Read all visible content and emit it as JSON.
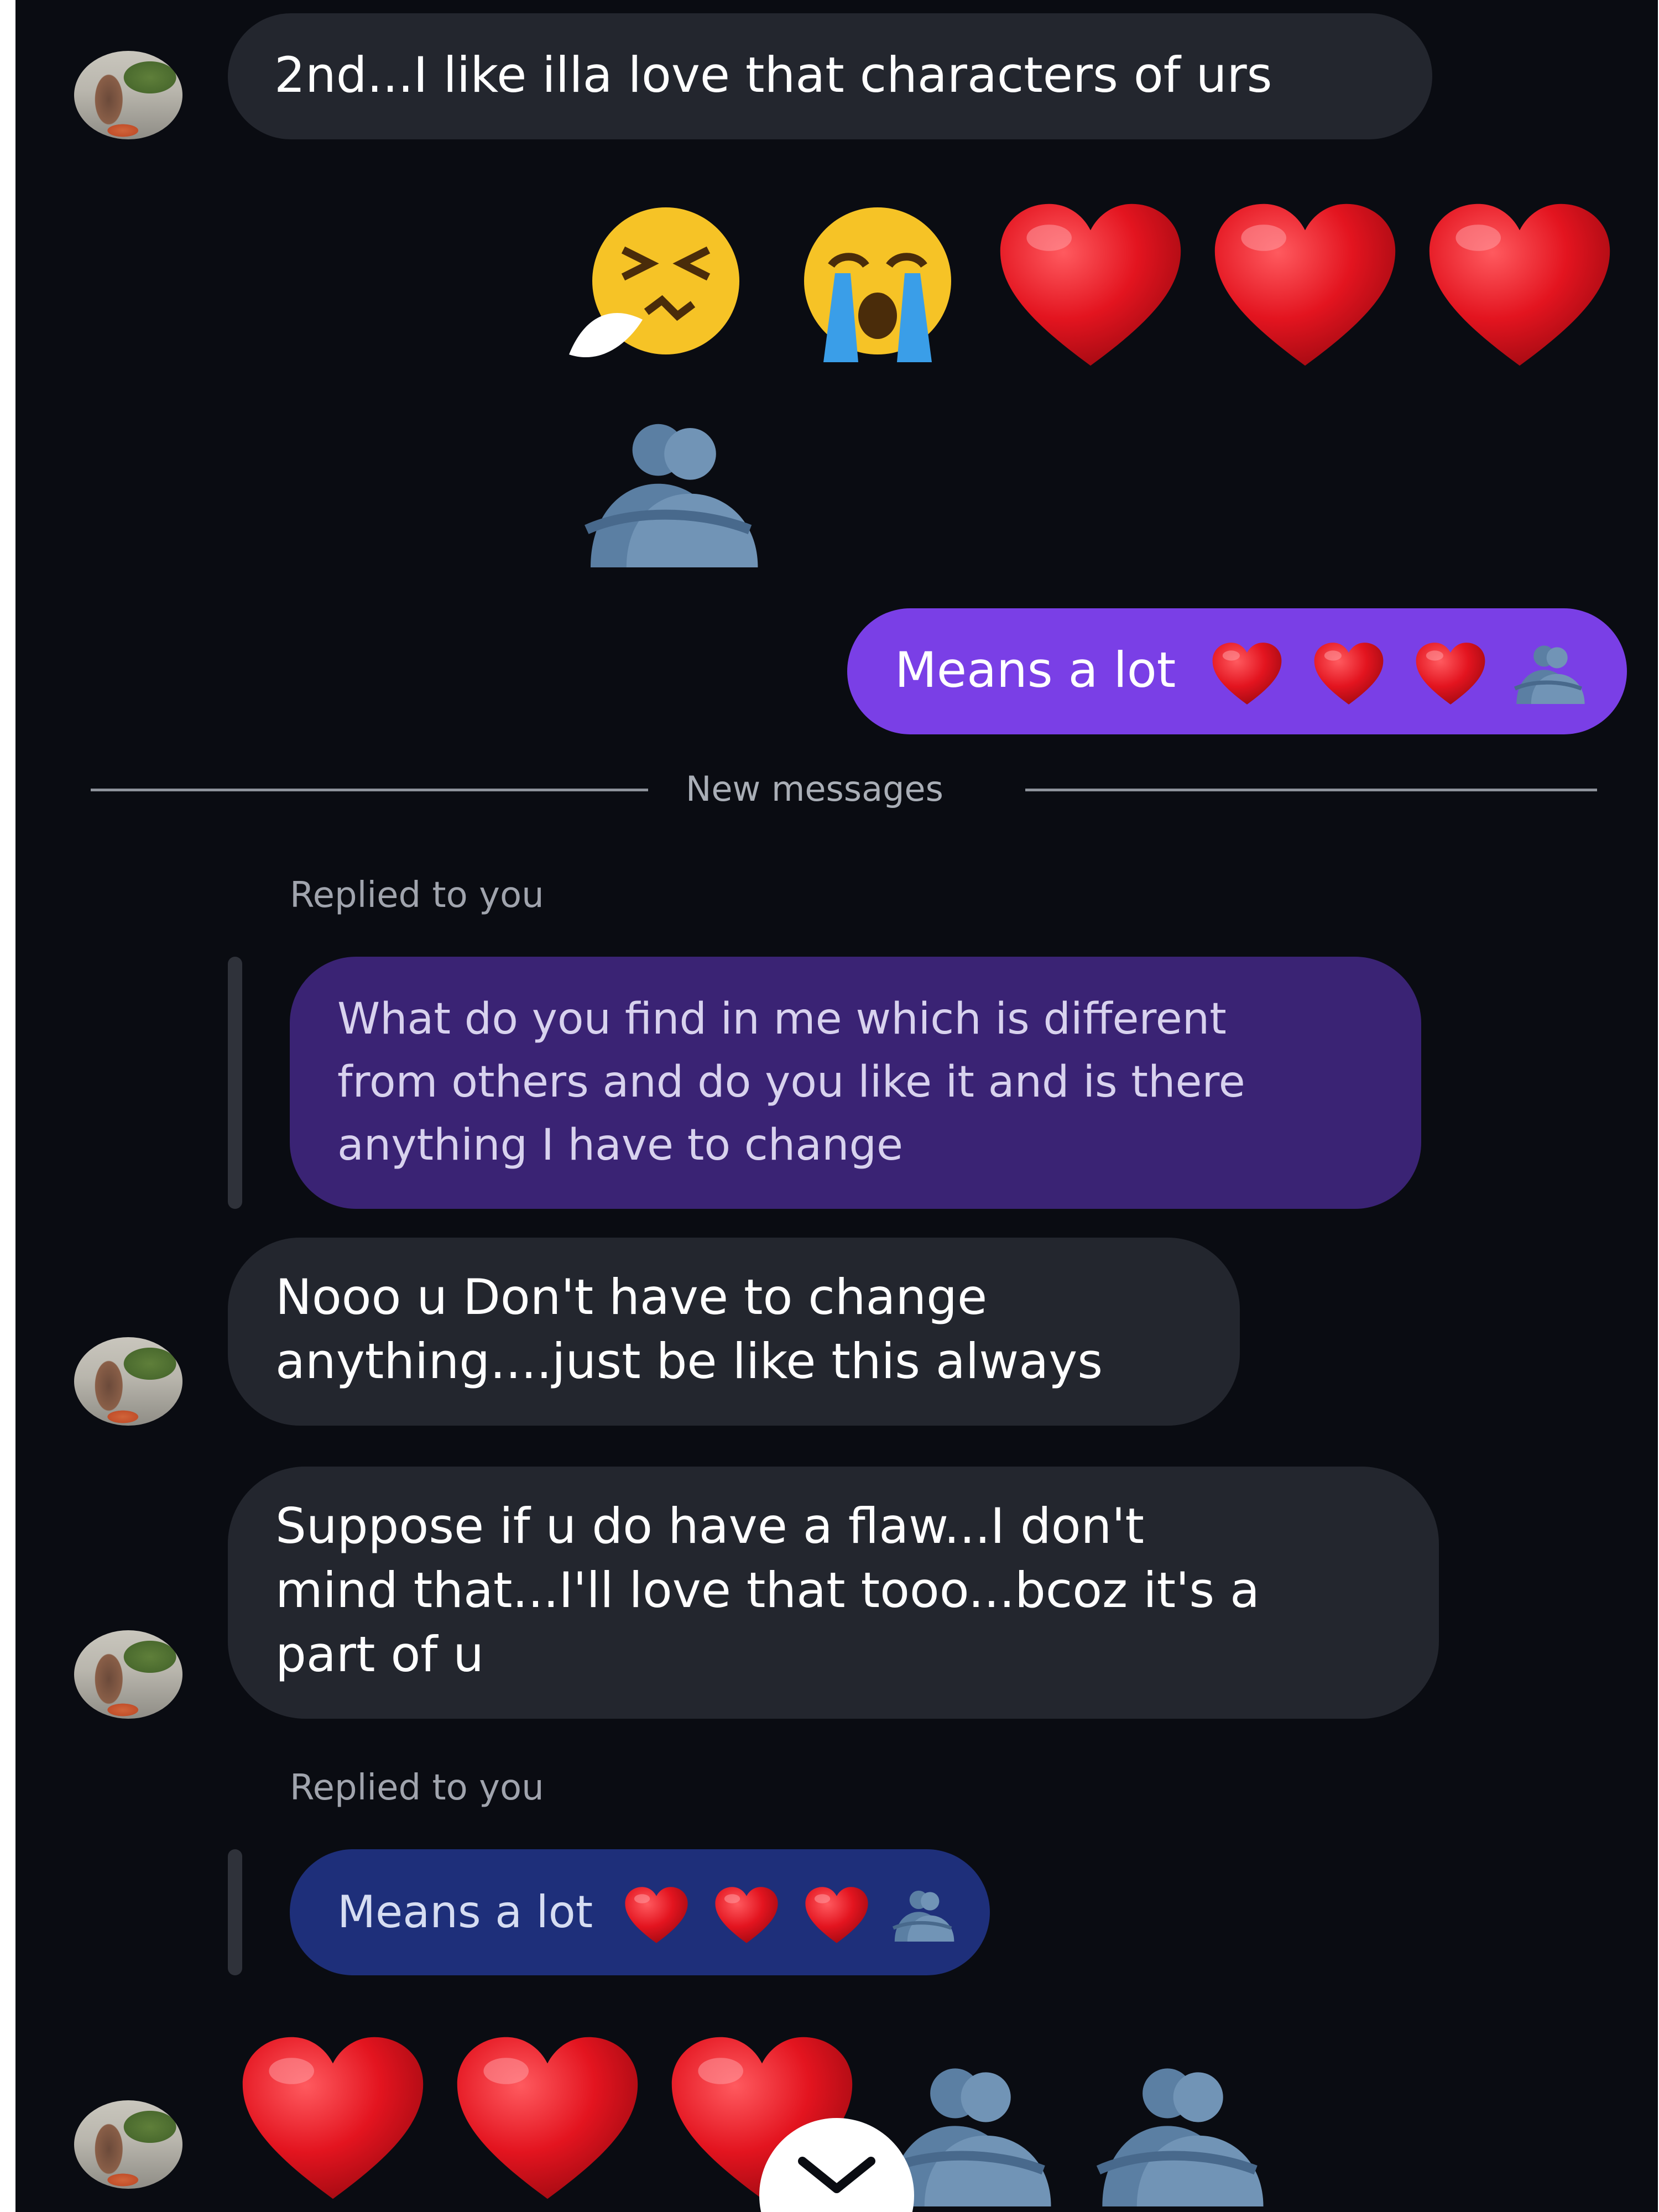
{
  "messages": {
    "m1": "2nd...I like illa love that characters of urs",
    "sent1": "Means a lot",
    "divider": "New messages",
    "reply_label_1": "Replied to you",
    "quoted_1_line1": "What do you find in me which is different",
    "quoted_1_line2": "from others and do you like it and is there",
    "quoted_1_line3": "anything I have to change",
    "m2_line1": "Nooo u Don't have to change",
    "m2_line2": "anything....just be like this always",
    "m3_line1": "Suppose if u do have a flaw...I don't",
    "m3_line2": "mind that...I'll love that tooo...bcoz it's a",
    "m3_line3": "part of u",
    "reply_label_2": "Replied to you",
    "quoted_2": "Means a lot"
  },
  "emoji_rows": {
    "row1": [
      "sneezing-face",
      "loudly-crying-face",
      "red-heart",
      "red-heart",
      "red-heart"
    ],
    "row2": [
      "people-hugging"
    ],
    "sent1_trailing": [
      "red-heart",
      "red-heart",
      "red-heart",
      "people-hugging"
    ],
    "quoted_2_trailing": [
      "red-heart",
      "red-heart",
      "red-heart",
      "people-hugging"
    ],
    "last_row": [
      "red-heart",
      "red-heart",
      "red-heart",
      "people-hugging",
      "people-hugging"
    ]
  },
  "colors": {
    "background": "#0a0c12",
    "incoming_bubble": "#23262e",
    "outgoing_bubble": "#7a3fe6",
    "quoted_outgoing": "#3a2374",
    "quoted_blue": "#1e2f7a",
    "heart": "#e0121f"
  },
  "icons": {
    "scroll_down": "chevron-down-icon"
  }
}
